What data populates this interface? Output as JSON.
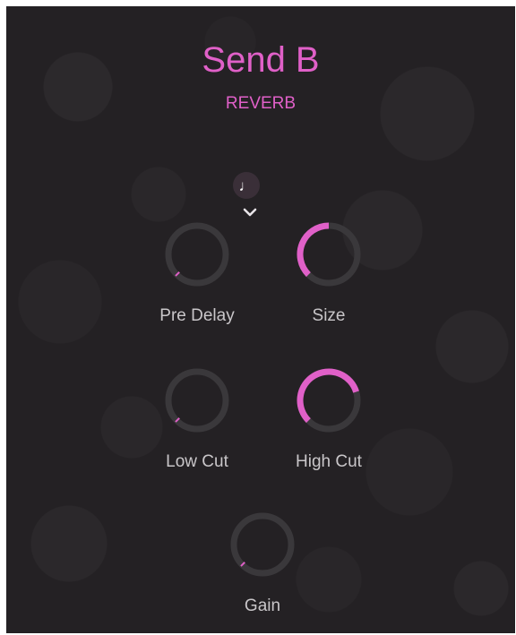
{
  "header": {
    "title": "Send B",
    "subtitle": "REVERB"
  },
  "icons": {
    "sync_note": "♩",
    "chevron": "chevron-down"
  },
  "colors": {
    "accent": "#e060c8",
    "track": "#3a383b",
    "label": "#c9c6c9",
    "background": "#242124"
  },
  "knobs": [
    {
      "id": "pre-delay",
      "label": "Pre Delay",
      "value": 0.0
    },
    {
      "id": "size",
      "label": "Size",
      "value": 0.5
    },
    {
      "id": "low-cut",
      "label": "Low Cut",
      "value": 0.0
    },
    {
      "id": "high-cut",
      "label": "High Cut",
      "value": 0.77
    },
    {
      "id": "gain",
      "label": "Gain",
      "value": 0.0
    }
  ]
}
